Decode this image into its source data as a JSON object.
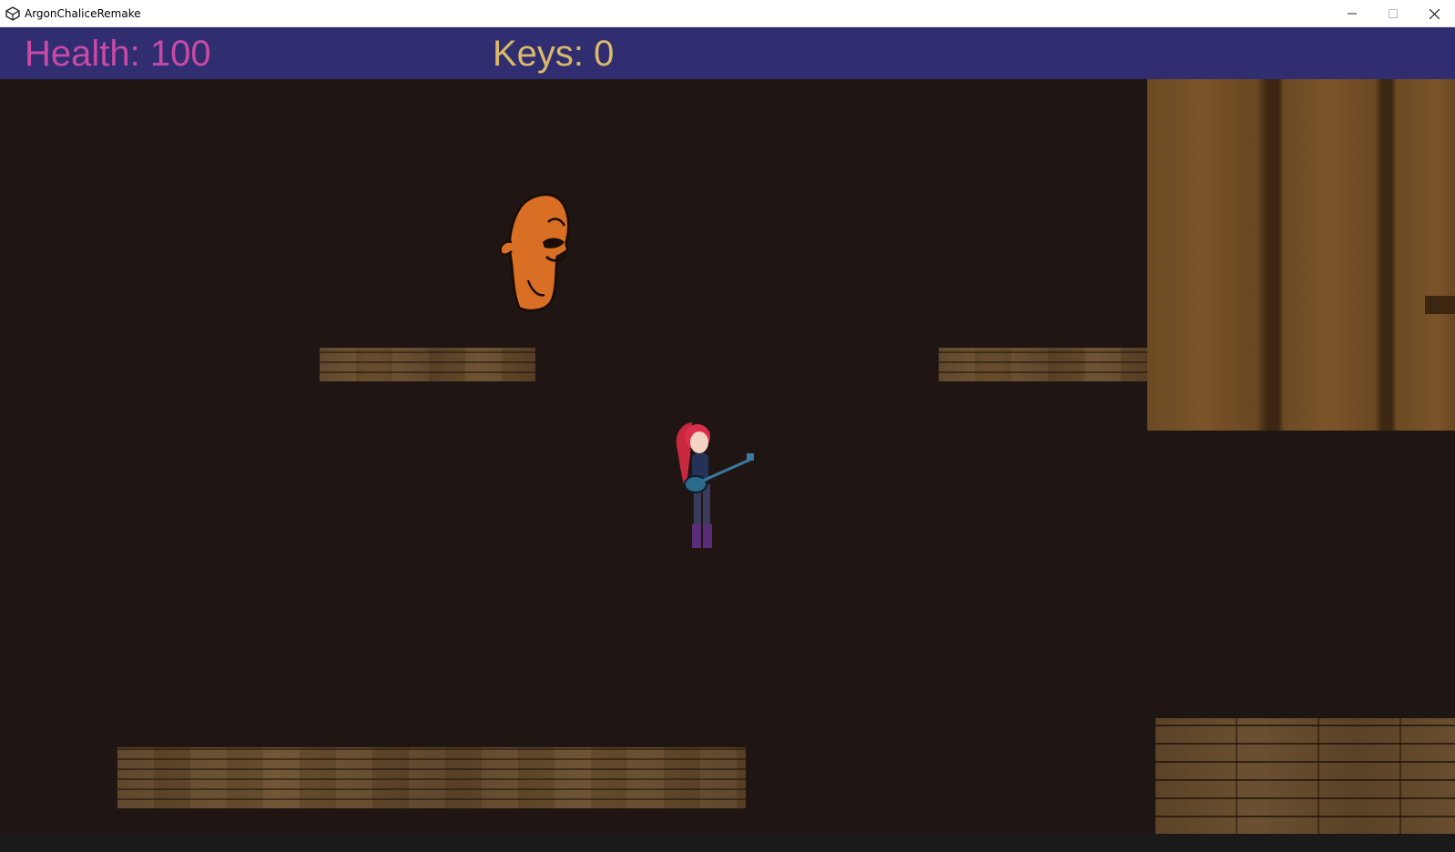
{
  "window": {
    "title": "ArgonChaliceRemake",
    "icon": "unity-icon",
    "controls": [
      "minimize-icon",
      "maximize-icon",
      "close-icon"
    ]
  },
  "hud": {
    "health_label": "Health: 100",
    "keys_label": "Keys: 0",
    "health_value": 100,
    "keys_value": 0,
    "health_color": "#c94aa6",
    "keys_color": "#d9b96a",
    "bar_color": "#302e70"
  },
  "scene": {
    "background_color": "#1f1614",
    "sprites": [
      "orange-ghost-enemy",
      "red-haired-guitarist-player"
    ],
    "platforms": [
      "wooden-platform-upper-left",
      "wooden-platform-upper-right",
      "wooden-platform-floor-left",
      "wooden-floor-block-right"
    ],
    "walls": [
      "wooden-wall-right"
    ]
  }
}
